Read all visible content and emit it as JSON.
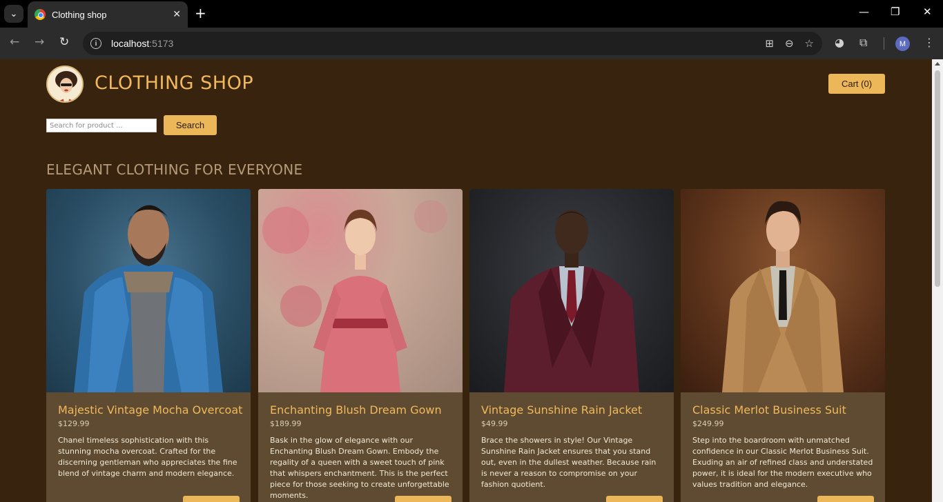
{
  "browser": {
    "tab_title": "Clothing shop",
    "url_host": "localhost",
    "url_port": ":5173",
    "profile_initial": "M"
  },
  "header": {
    "brand": "CLOTHING SHOP",
    "cart_label": "Cart (0)"
  },
  "search": {
    "placeholder": "Search for product ...",
    "button_label": "Search"
  },
  "section_title": "ELEGANT CLOTHING FOR EVERYONE",
  "products": [
    {
      "name": "Majestic Vintage Mocha Overcoat",
      "price": "$129.99",
      "description": "Chanel timeless sophistication with this stunning mocha overcoat. Crafted for the discerning gentleman who appreciates the fine blend of vintage charm and modern elegance.",
      "image": "man-in-denim-jacket"
    },
    {
      "name": "Enchanting Blush Dream Gown",
      "price": "$189.99",
      "description": "Bask in the glow of elegance with our Enchanting Blush Dream Gown. Embody the regality of a queen with a sweet touch of pink that whispers enchantment. This is the perfect piece for those seeking to create unforgettable moments.",
      "image": "woman-in-pink-dress"
    },
    {
      "name": "Vintage Sunshine Rain Jacket",
      "price": "$49.99",
      "description": "Brace the showers in style! Our Vintage Sunshine Rain Jacket ensures that you stand out, even in the dullest weather. Because rain is never a reason to compromise on your fashion quotient.",
      "image": "man-in-burgundy-suit"
    },
    {
      "name": "Classic Merlot Business Suit",
      "price": "$249.99",
      "description": "Step into the boardroom with unmatched confidence in our Classic Merlot Business Suit. Exuding an air of refined class and understated power, it is ideal for the modern executive who values tradition and elegance.",
      "image": "man-in-trench-coat"
    }
  ]
}
